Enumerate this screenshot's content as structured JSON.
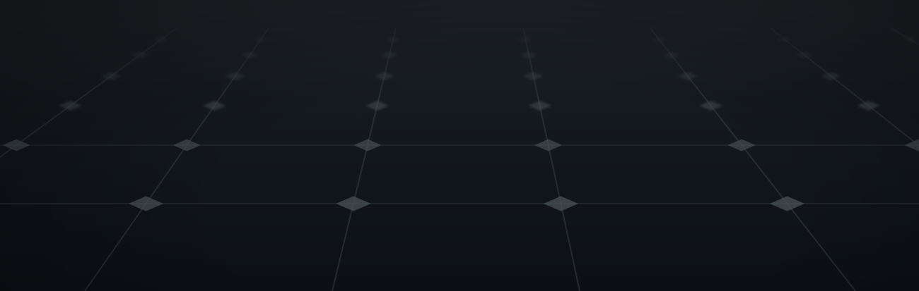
{
  "banner": {
    "subject": "solar-panel-cells",
    "colors": {
      "cell_fill": "#0f1419",
      "grid_line": "#3a4046",
      "node_highlight": "#4a5056",
      "sky": "#1c2126"
    }
  }
}
